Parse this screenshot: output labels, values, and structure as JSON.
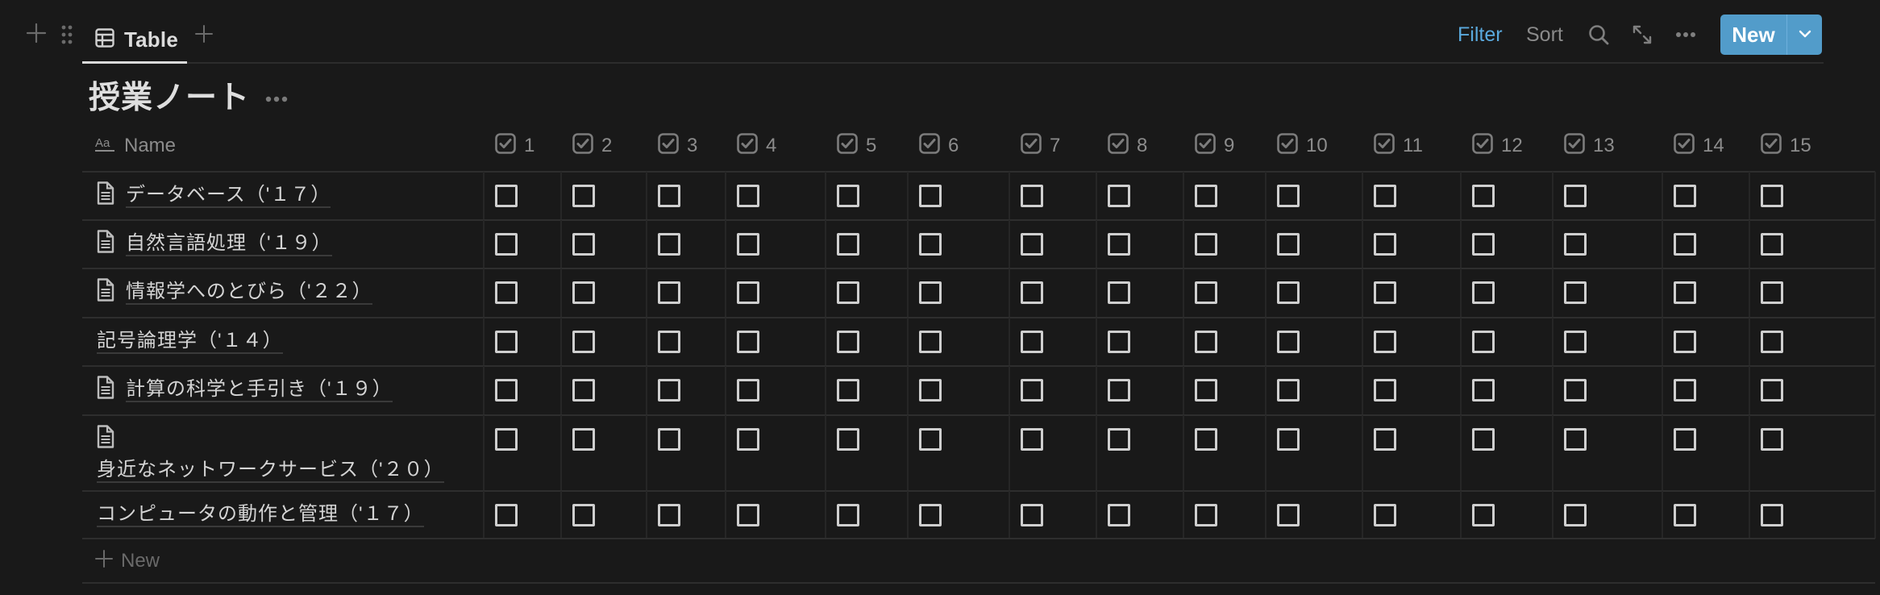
{
  "top_bar": {
    "add_block_icon": "plus-icon",
    "drag_handle_icon": "drag-handle-icon",
    "tabs": [
      {
        "label": "Table",
        "icon": "table-icon",
        "active": true
      }
    ],
    "add_view_icon": "plus-icon"
  },
  "toolbar": {
    "filter_label": "Filter",
    "sort_label": "Sort",
    "search_icon": "search-icon",
    "expand_icon": "expand-icon",
    "more_icon": "more-horizontal-icon",
    "new_label": "New",
    "new_dropdown_icon": "chevron-down-icon",
    "accent_color": "#529cca",
    "filter_color": "#5aa9dd"
  },
  "database": {
    "title": "授業ノート",
    "title_more_icon": "more-horizontal-icon"
  },
  "table": {
    "name_column": {
      "label": "Name",
      "icon": "text-property-icon"
    },
    "checkbox_columns": [
      "1",
      "2",
      "3",
      "4",
      "5",
      "6",
      "7",
      "8",
      "9",
      "10",
      "11",
      "12",
      "13",
      "14",
      "15"
    ],
    "rows": [
      {
        "name": "データベース（'１７）",
        "has_page_icon": true,
        "checked": [
          false,
          false,
          false,
          false,
          false,
          false,
          false,
          false,
          false,
          false,
          false,
          false,
          false,
          false,
          false
        ]
      },
      {
        "name": "自然言語処理（'１９）",
        "has_page_icon": true,
        "checked": [
          false,
          false,
          false,
          false,
          false,
          false,
          false,
          false,
          false,
          false,
          false,
          false,
          false,
          false,
          false
        ]
      },
      {
        "name": "情報学へのとびら（'２２）",
        "has_page_icon": true,
        "checked": [
          false,
          false,
          false,
          false,
          false,
          false,
          false,
          false,
          false,
          false,
          false,
          false,
          false,
          false,
          false
        ]
      },
      {
        "name": "記号論理学（'１４）",
        "has_page_icon": false,
        "checked": [
          false,
          false,
          false,
          false,
          false,
          false,
          false,
          false,
          false,
          false,
          false,
          false,
          false,
          false,
          false
        ]
      },
      {
        "name": "計算の科学と手引き（'１９）",
        "has_page_icon": true,
        "checked": [
          false,
          false,
          false,
          false,
          false,
          false,
          false,
          false,
          false,
          false,
          false,
          false,
          false,
          false,
          false
        ]
      },
      {
        "name": "身近なネットワークサービス（'２０）",
        "has_page_icon": true,
        "checked": [
          false,
          false,
          false,
          false,
          false,
          false,
          false,
          false,
          false,
          false,
          false,
          false,
          false,
          false,
          false
        ]
      },
      {
        "name": "コンピュータの動作と管理（'１７）",
        "has_page_icon": false,
        "checked": [
          false,
          false,
          false,
          false,
          false,
          false,
          false,
          false,
          false,
          false,
          false,
          false,
          false,
          false,
          false
        ]
      }
    ],
    "new_row_label": "New"
  }
}
